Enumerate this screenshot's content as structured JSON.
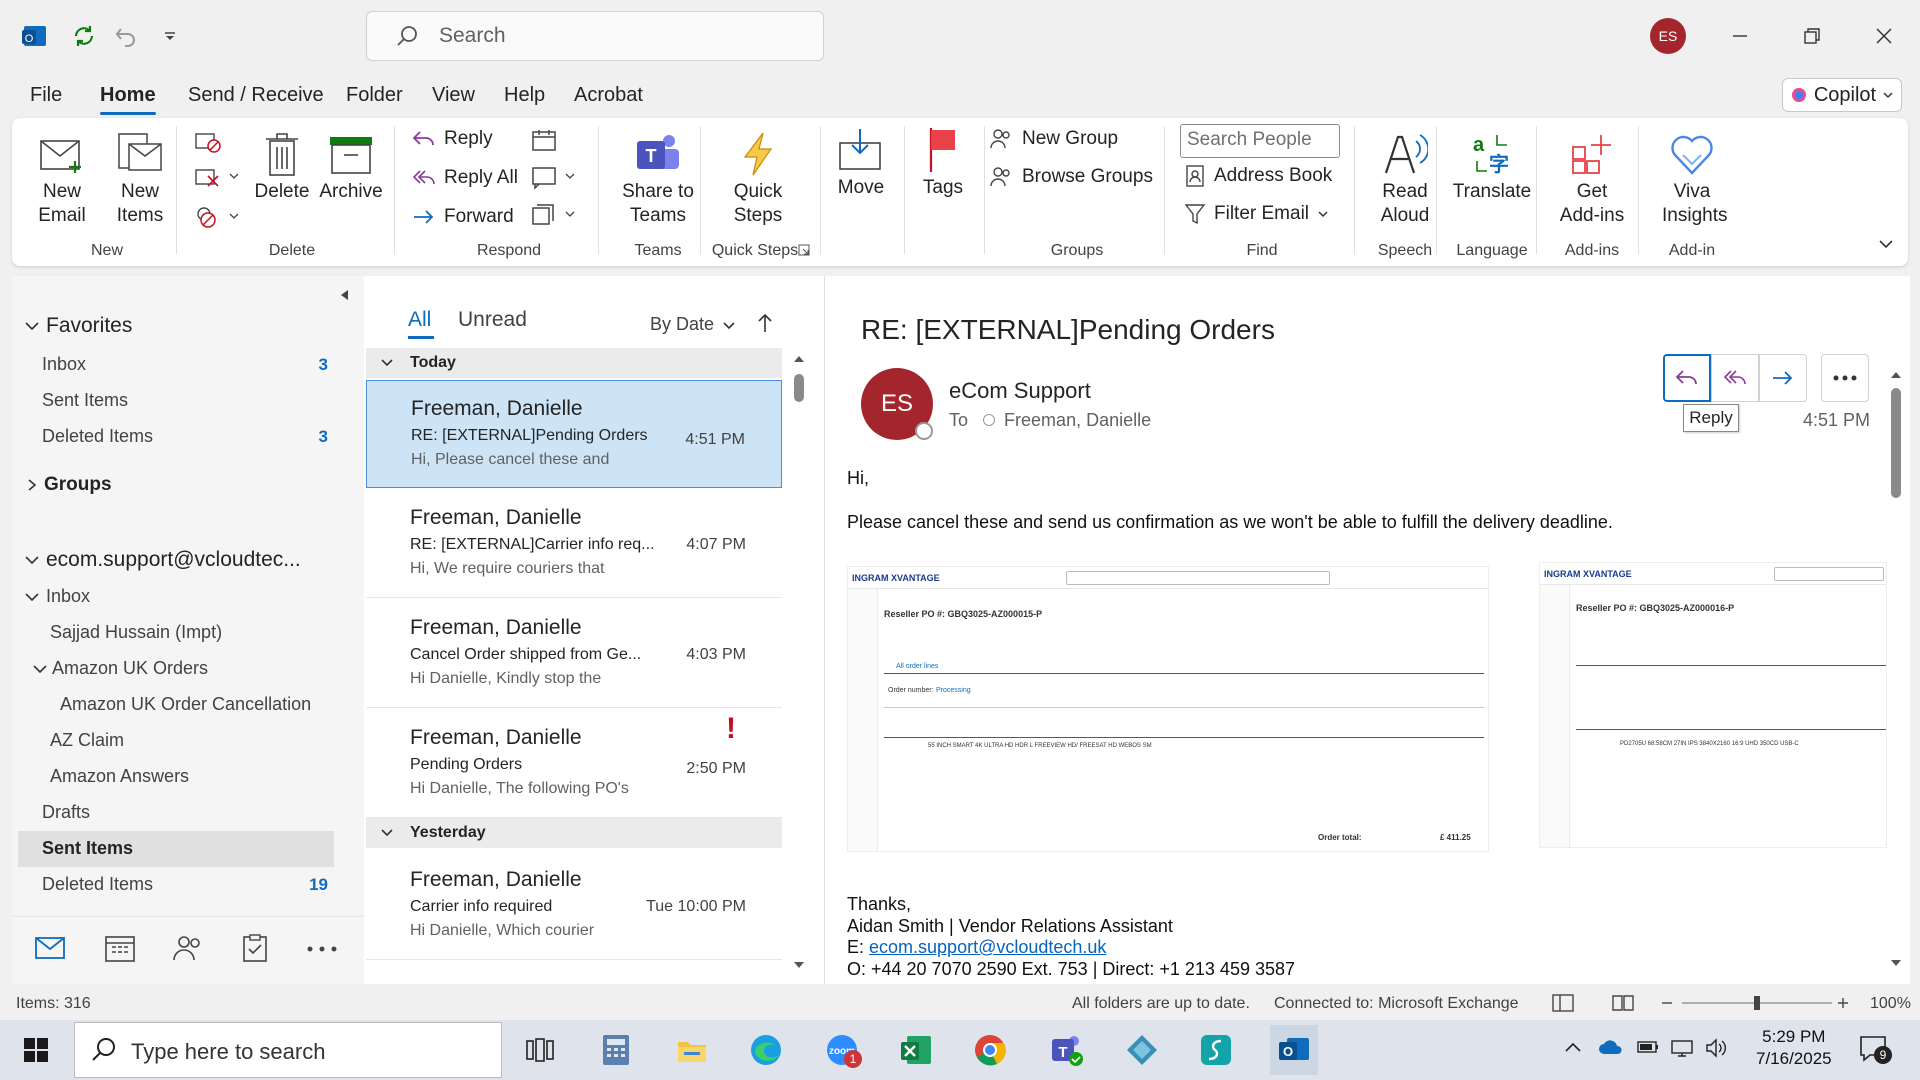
{
  "titlebar": {
    "search_placeholder": "Search",
    "user_initials": "ES"
  },
  "menu": {
    "tabs": [
      "File",
      "Home",
      "Send / Receive",
      "Folder",
      "View",
      "Help",
      "Acrobat"
    ],
    "active": "Home",
    "copilot_label": "Copilot"
  },
  "ribbon": {
    "new": {
      "new_email": "New Email",
      "new_items": "New Items",
      "group": "New"
    },
    "delete": {
      "delete": "Delete",
      "archive": "Archive",
      "group": "Delete"
    },
    "respond": {
      "reply": "Reply",
      "reply_all": "Reply All",
      "forward": "Forward",
      "group": "Respond"
    },
    "teams": {
      "share": "Share to Teams",
      "group": "Teams"
    },
    "quicksteps": {
      "label": "Quick Steps",
      "group": "Quick Steps"
    },
    "move": {
      "label": "Move"
    },
    "tags": {
      "label": "Tags"
    },
    "groups": {
      "new_group": "New Group",
      "browse_groups": "Browse Groups",
      "group": "Groups"
    },
    "find": {
      "search_people": "Search People",
      "address_book": "Address Book",
      "filter_email": "Filter Email",
      "group": "Find"
    },
    "speech": {
      "read_aloud": "Read Aloud",
      "group": "Speech"
    },
    "language": {
      "translate": "Translate",
      "group": "Language"
    },
    "addins": {
      "get_addins": "Get Add-ins",
      "group": "Add-ins"
    },
    "viva": {
      "label": "Viva Insights",
      "group": "Add-in"
    }
  },
  "folders": {
    "favorites_label": "Favorites",
    "favorites": [
      {
        "name": "Inbox",
        "count": "3"
      },
      {
        "name": "Sent Items",
        "count": ""
      },
      {
        "name": "Deleted Items",
        "count": "3"
      }
    ],
    "groups_label": "Groups",
    "account": "ecom.support@vcloudtec...",
    "inbox": "Inbox",
    "subfolders": [
      "Sajjad Hussain (Impt)",
      "Amazon UK Orders",
      "Amazon UK Order Cancellation",
      "AZ Claim",
      "Amazon Answers"
    ],
    "drafts": "Drafts",
    "sent": "Sent Items",
    "deleted": "Deleted Items",
    "deleted_count": "19"
  },
  "list": {
    "tab_all": "All",
    "tab_unread": "Unread",
    "sort": "By Date",
    "group_today": "Today",
    "group_yesterday": "Yesterday",
    "messages": [
      {
        "sender": "Freeman, Danielle",
        "subject": "RE: [EXTERNAL]Pending Orders",
        "preview": "Hi,  Please cancel these and",
        "time": "4:51 PM"
      },
      {
        "sender": "Freeman, Danielle",
        "subject": "RE: [EXTERNAL]Carrier info req...",
        "preview": "Hi,  We require couriers that",
        "time": "4:07 PM"
      },
      {
        "sender": "Freeman, Danielle",
        "subject": "Cancel Order shipped from Ge...",
        "preview": "Hi Danielle,  Kindly stop the",
        "time": "4:03 PM"
      },
      {
        "sender": "Freeman, Danielle",
        "subject": "Pending Orders",
        "preview": "Hi Danielle,  The following PO's",
        "time": "2:50 PM",
        "flag": "!"
      },
      {
        "sender": "Freeman, Danielle",
        "subject": "Carrier info required",
        "preview": "Hi Danielle,  Which courier",
        "time": "Tue 10:00 PM"
      }
    ]
  },
  "reading": {
    "subject": "RE: [EXTERNAL]Pending Orders",
    "sender_initials": "ES",
    "sender": "eCom Support",
    "to_label": "To",
    "recipient": "Freeman, Danielle",
    "time": "4:51 PM",
    "tooltip": "Reply",
    "greeting": "Hi,",
    "body": "Please cancel these and send us confirmation as we won't be able to fulfill the delivery deadline.",
    "thanks": "Thanks,",
    "signature": "Aidan Smith | Vendor Relations Assistant",
    "email_prefix": "E: ",
    "email": "ecom.support@vcloudtech.uk",
    "phone": "O:  +44 20 7070 2590 Ext. 753 | Direct: +1 213 459 3587",
    "shot1": {
      "brand": "INGRAM  XVANTAGE",
      "po": "Reseller PO #: GBQ3025-AZ000015-P",
      "tab": "All order lines",
      "order_number": "Order number:",
      "status": "Processing",
      "item": "55 INCH SMART 4K ULTRA HD HDR L FREEVIEW HD/ FREESAT HD WEBOS SM",
      "total_label": "Order total:",
      "total": "£ 411.25"
    },
    "shot2": {
      "brand": "INGRAM  XVANTAGE",
      "po": "Reseller PO #: GBQ3025-AZ000016-P",
      "item": "PD2705U 68.58CM 27IN IPS 3840X2160 16:9 UHD 350CD USB-C"
    }
  },
  "status": {
    "items": "Items: 316",
    "sync": "All folders are up to date.",
    "connection": "Connected to: Microsoft Exchange",
    "zoom": "100%"
  },
  "taskbar": {
    "search": "Type here to search",
    "time": "5:29 PM",
    "date": "7/16/2025",
    "zoom_badge": "1",
    "notif": "9"
  }
}
